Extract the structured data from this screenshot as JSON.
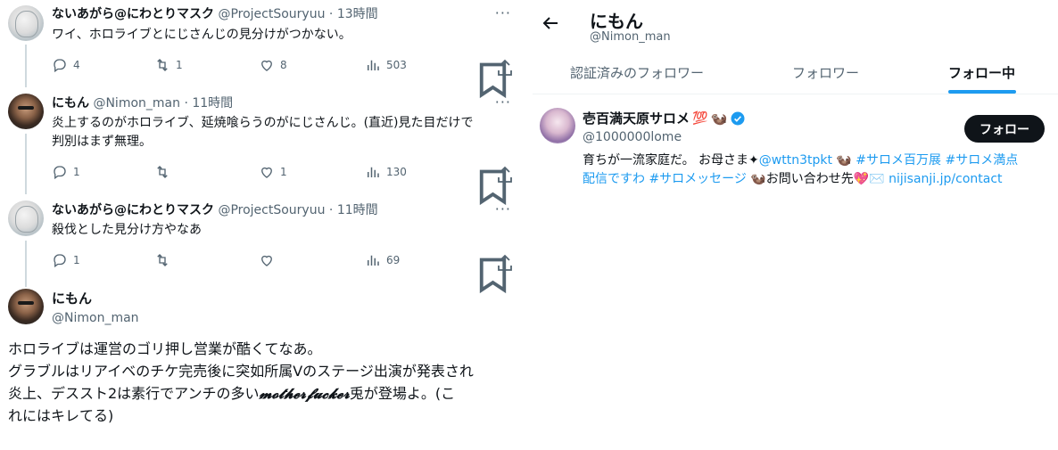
{
  "thread": [
    {
      "name": "ないあがら@にわとりマスク",
      "handle": "@ProjectSouryuu",
      "dot": "·",
      "time": "13時間",
      "text": "ワイ、ホロライブとにじさんじの見分けがつかない。",
      "replies": "4",
      "retweets": "1",
      "likes": "8",
      "views": "503",
      "avatar_icon": "sketch-avatar-icon"
    },
    {
      "name": "にもん",
      "handle": "@Nimon_man",
      "dot": "·",
      "time": "11時間",
      "text_line1": "炎上するのがホロライブ、延焼喰らうのがにじさんじ。(直近)見た目だけで",
      "text_line2": "判別はまず無理。",
      "replies": "1",
      "retweets": "",
      "likes": "1",
      "views": "130",
      "avatar_icon": "man-avatar-icon"
    },
    {
      "name": "ないあがら@にわとりマスク",
      "handle": "@ProjectSouryuu",
      "dot": "·",
      "time": "11時間",
      "text": "殺伐とした見分け方やなあ",
      "replies": "1",
      "retweets": "",
      "likes": "",
      "views": "69",
      "avatar_icon": "sketch-avatar-icon"
    }
  ],
  "main_tweet": {
    "name": "にもん",
    "handle": "@Nimon_man",
    "line1": "ホロライブは運営のゴリ押し営業が酷くてなあ。",
    "line2": "グラブルはリアイベのチケ完売後に突如所属Vのステージ出演が発表され",
    "line3_a": "炎上、デススト2は素行でアンチの多い",
    "line3_script": "𝓶𝓸𝓽𝓱𝓮𝓻𝓯𝓾𝓬𝓴𝓮𝓻",
    "line3_b": "兎が登場よ。(こ",
    "line4": "れにはキレてる)"
  },
  "more_glyph": "···",
  "right_panel": {
    "title": "にもん",
    "subtitle": "@Nimon_man",
    "tabs": [
      "認証済みのフォロワー",
      "フォロワー",
      "フォロー中"
    ],
    "active_tab": "フォロー中",
    "user": {
      "name": "壱百満天原サロメ",
      "name_emoji": "💯",
      "name_emoji2": "🦦",
      "handle": "@1000000lome",
      "follow_label": "フォロー",
      "bio_1": "育ちが一流家庭だ。 お母さま✦",
      "bio_mention": "@wttn3tpkt",
      "bio_2": " 🦦 ",
      "bio_tag1": "#サロメ百万展",
      "bio_tag2": "#サロメ満点",
      "bio_tag3": "配信ですわ",
      "bio_tag4": "#サロメッセージ",
      "bio_3": " 🦦お問い合わせ先💖✉️ ",
      "bio_link": "nijisanji.jp/contact"
    }
  },
  "colors": {
    "text": "#0f1419",
    "muted": "#536471",
    "accent": "#1d9bf0",
    "thread_line": "#cfd9de",
    "button_bg": "#0f1419"
  },
  "icons": {
    "reply": "reply-icon",
    "retweet": "retweet-icon",
    "like": "heart-icon",
    "views": "views-icon",
    "bookmark": "bookmark-icon",
    "share": "share-icon",
    "back": "back-arrow-icon",
    "verified": "verified-badge-icon"
  }
}
